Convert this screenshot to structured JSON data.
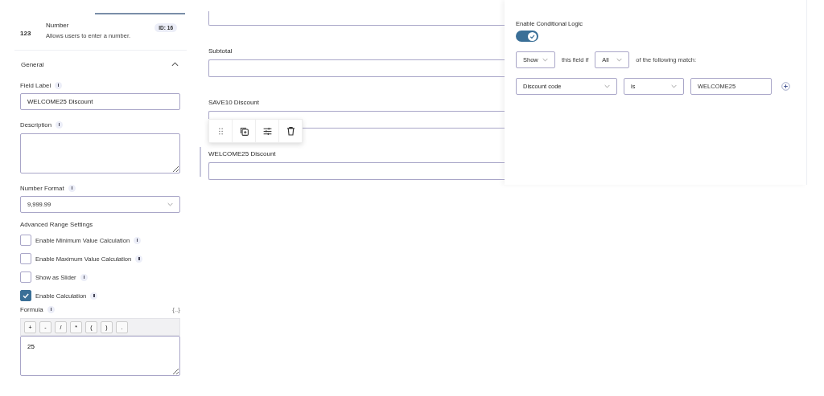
{
  "field_header": {
    "icon_text": "123",
    "title": "Number",
    "description": "Allows users to enter a number.",
    "id_badge": "ID: 16"
  },
  "section": {
    "title": "General",
    "expanded": true
  },
  "field_label": {
    "label": "Field Label",
    "value": "WELCOME25 Discount"
  },
  "description": {
    "label": "Description"
  },
  "number_format": {
    "label": "Number Format",
    "value": "9,999.99"
  },
  "advanced_title": "Advanced Range Settings",
  "options": [
    {
      "label": "Enable Minimum Value Calculation",
      "checked": false
    },
    {
      "label": "Enable Maximum Value Calculation",
      "checked": false
    },
    {
      "label": "Show as Slider",
      "checked": false
    },
    {
      "label": "Enable Calculation",
      "checked": true
    }
  ],
  "formula": {
    "label": "Formula",
    "merge_tag": "{..}",
    "operators": [
      "+",
      "-",
      "/",
      "*",
      "(",
      ")",
      "."
    ],
    "value": "25"
  },
  "canvas_fields": [
    {
      "selected": false
    },
    {
      "label": "Subtotal",
      "selected": false
    },
    {
      "label": "SAVE10 Discount",
      "selected": false
    },
    {
      "label": "WELCOME25 Discount",
      "selected": true
    }
  ],
  "conditional_logic": {
    "label": "Enable Conditional Logic",
    "on": true,
    "action": "Show",
    "text_1": "this field if",
    "match": "All",
    "text_2": "of the following match:",
    "rule": {
      "field": "Discount code",
      "operator": "is",
      "value": "WELCOME25"
    }
  }
}
